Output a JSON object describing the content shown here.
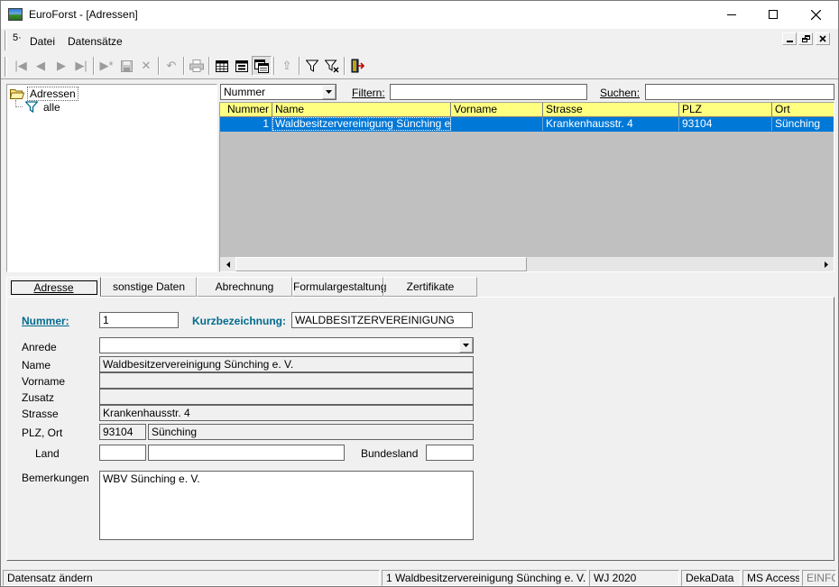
{
  "window": {
    "title": "EuroForst - [Adressen]"
  },
  "menu": {
    "items": [
      "Datei",
      "Datensätze"
    ]
  },
  "tree": {
    "root": "Adressen",
    "child": "alle"
  },
  "filterbar": {
    "sort_value": "Nummer",
    "filter_label": "Filtern:",
    "filter_value": "",
    "search_label": "Suchen:",
    "search_value": ""
  },
  "grid": {
    "columns": [
      "Nummer",
      "Name",
      "Vorname",
      "Strasse",
      "PLZ",
      "Ort"
    ],
    "rows": [
      {
        "nummer": "1",
        "name": "Waldbesitzervereinigung Sünching e. V.",
        "vorname": "",
        "strasse": "Krankenhausstr. 4",
        "plz": "93104",
        "ort": "Sünching"
      }
    ]
  },
  "tabs": [
    "Adresse",
    "sonstige Daten",
    "Abrechnung",
    "Formulargestaltung",
    "Zertifikate"
  ],
  "form": {
    "nummer_label": "Nummer:",
    "nummer_value": "1",
    "kurz_label": "Kurzbezeichnung:",
    "kurz_value": "WALDBESITZERVEREINIGUNG",
    "anrede_label": "Anrede",
    "anrede_value": "",
    "name_label": "Name",
    "name_value": "Waldbesitzervereinigung Sünching e. V.",
    "vorname_label": "Vorname",
    "vorname_value": "",
    "zusatz_label": "Zusatz",
    "zusatz_value": "",
    "strasse_label": "Strasse",
    "strasse_value": "Krankenhausstr. 4",
    "plzort_label": "PLZ, Ort",
    "plz_value": "93104",
    "ort_value": "Sünching",
    "land_label": "Land",
    "land_code": "",
    "land_value": "",
    "bundesland_label": "Bundesland",
    "bundesland_value": "",
    "bemerkungen_label": "Bemerkungen",
    "bemerkungen_value": "WBV Sünching e. V."
  },
  "status": {
    "action": "Datensatz ändern",
    "record": "1 Waldbesitzervereinigung Sünching e. V.",
    "year": "WJ 2020",
    "vendor": "DekaData",
    "db": "MS Access",
    "mode": "EINFG"
  },
  "colors": {
    "grid_header": "#ffff80",
    "selection": "#0078d7",
    "label_accent": "#006a8e",
    "grid_bg": "#c0c0c0"
  }
}
